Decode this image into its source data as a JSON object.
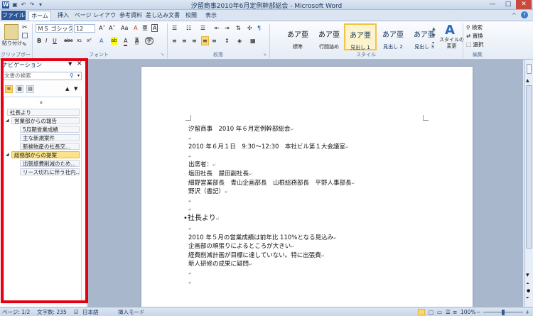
{
  "window": {
    "title": "汐留商事2010年6月定例幹部総会 - Microsoft Word",
    "minimize": "—",
    "maximize": "□",
    "close": "✕",
    "help": "?"
  },
  "quick_access": {
    "save": "▣",
    "undo": "↶",
    "redo": "↷",
    "customize": "▾"
  },
  "tabs": [
    "ファイル",
    "ホーム",
    "挿入",
    "ページ レイアウト",
    "参考資料",
    "差し込み文書",
    "校閲",
    "表示"
  ],
  "ribbon": {
    "clipboard": {
      "paste": "貼り付け",
      "group": "クリップボード"
    },
    "font": {
      "name": "ＭＳ ゴシック（",
      "size": "12",
      "group": "フォント",
      "grow": "A˄",
      "shrink": "A˅",
      "case": "Aa",
      "clear": "A",
      "phon": "亜",
      "box": "A",
      "bold": "B",
      "italic": "I",
      "underline": "U",
      "strike": "abc",
      "sub": "x₂",
      "sup": "x²",
      "effects": "A",
      "highlight": "ab",
      "color": "A",
      "shade": "A",
      "enclosed": "字"
    },
    "paragraph": {
      "group": "段落"
    },
    "styles": {
      "group": "スタイル",
      "items": [
        {
          "preview": "あア亜",
          "name": "標準"
        },
        {
          "preview": "あア亜",
          "name": "行間詰め"
        },
        {
          "preview": "あア亜",
          "name": "見出し 1"
        },
        {
          "preview": "あア亜",
          "name": "見出し 2"
        },
        {
          "preview": "あア亜",
          "name": "見出し 3"
        }
      ],
      "change": "スタイルの",
      "change2": "変更"
    },
    "editing": {
      "group": "編集",
      "find": "検索",
      "replace": "置換",
      "select": "選択"
    }
  },
  "nav": {
    "title": "ナビゲーション",
    "search_placeholder": "文書の検索",
    "items": [
      {
        "label": "社長より",
        "level": 0,
        "selected": false
      },
      {
        "label": "営業部からの報告",
        "level": 0,
        "selected": false,
        "expanded": true
      },
      {
        "label": "5月期営業成績",
        "level": 1,
        "selected": false
      },
      {
        "label": "主な新規案件",
        "level": 1,
        "selected": false
      },
      {
        "label": "新検物産の社長交...",
        "level": 1,
        "selected": false
      },
      {
        "label": "総務部からの提案",
        "level": 0,
        "selected": true,
        "expanded": true
      },
      {
        "label": "出張旅費削減のため...",
        "level": 1,
        "selected": false
      },
      {
        "label": "リース切れに伴う社内...",
        "level": 1,
        "selected": false
      }
    ]
  },
  "document": {
    "lines": [
      "汐留商事　2010 年６月定例幹部総会",
      "",
      "2010 年６月１日　9:30〜12:30　本社ビル第１大会議室",
      "",
      "出席者：",
      "塩田社長　屋田副社長",
      "細野営業部長　青山企画部長　山根総務部長　平野人事部長",
      "野沢（書記）",
      "",
      "",
      "社長より",
      "",
      "2010 年５月の営業成績は前年比 110%となる見込み",
      "企画部の頑張りによるところが大きい",
      "経費削減計画が目標に達していない。特に出張費",
      "新人研修の成果に疑問",
      "",
      ""
    ],
    "heading_index": 10
  },
  "status": {
    "page": "ページ: 1/2",
    "words": "文字数: 235",
    "language": "日本語",
    "mode": "挿入モード",
    "zoom": "100%",
    "zoom_minus": "−",
    "zoom_plus": "+"
  }
}
